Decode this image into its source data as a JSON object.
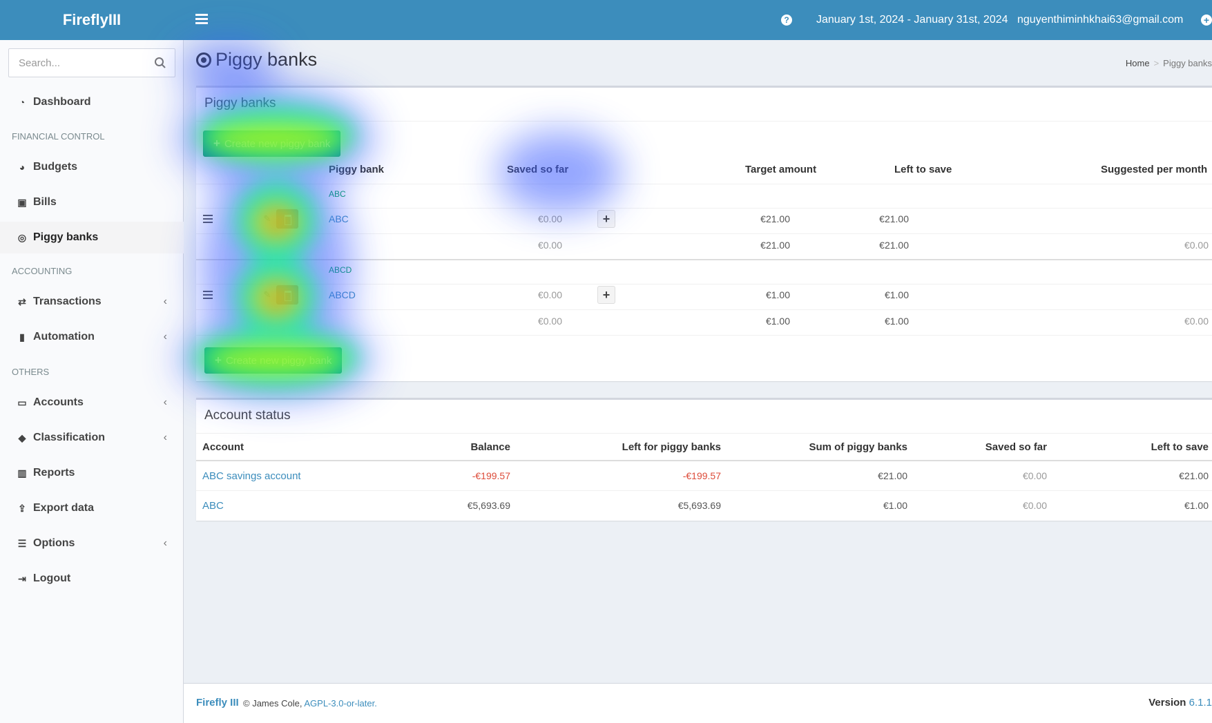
{
  "header": {
    "logo": "FireflyIII",
    "date_range": "January 1st, 2024 - January 31st, 2024",
    "user_email": "nguyenthiminhkhai63@gmail.com"
  },
  "sidebar": {
    "search_placeholder": "Search...",
    "items": [
      {
        "label": "Dashboard"
      },
      {
        "label": "Budgets"
      },
      {
        "label": "Bills"
      },
      {
        "label": "Piggy banks"
      },
      {
        "label": "Transactions"
      },
      {
        "label": "Automation"
      },
      {
        "label": "Accounts"
      },
      {
        "label": "Classification"
      },
      {
        "label": "Reports"
      },
      {
        "label": "Export data"
      },
      {
        "label": "Options"
      },
      {
        "label": "Logout"
      }
    ],
    "headers": [
      "FINANCIAL CONTROL",
      "ACCOUNTING",
      "OTHERS"
    ]
  },
  "page": {
    "title": "Piggy banks",
    "breadcrumb": [
      "Home",
      "Piggy banks"
    ]
  },
  "piggy_box": {
    "title": "Piggy banks",
    "create_label": "Create new piggy bank",
    "columns": [
      "Piggy bank",
      "Saved so far",
      "Target amount",
      "Left to save",
      "Suggested per month"
    ],
    "groups": [
      {
        "account": "ABC",
        "name": "ABC",
        "saved": "€0.00",
        "target": "€21.00",
        "left": "€21.00",
        "sum_saved": "€0.00",
        "sum_target": "€21.00",
        "sum_left": "€21.00",
        "sum_suggested": "€0.00"
      },
      {
        "account": "ABCD",
        "name": "ABCD",
        "saved": "€0.00",
        "target": "€1.00",
        "left": "€1.00",
        "sum_saved": "€0.00",
        "sum_target": "€1.00",
        "sum_left": "€1.00",
        "sum_suggested": "€0.00"
      }
    ]
  },
  "account_box": {
    "title": "Account status",
    "columns": [
      "Account",
      "Balance",
      "Left for piggy banks",
      "Sum of piggy banks",
      "Saved so far",
      "Left to save"
    ],
    "rows": [
      {
        "account": "ABC savings account",
        "balance": "-€199.57",
        "left_for": "-€199.57",
        "sum": "€21.00",
        "saved": "€0.00",
        "left": "€21.00"
      },
      {
        "account": "ABC",
        "balance": "€5,693.69",
        "left_for": "€5,693.69",
        "sum": "€1.00",
        "saved": "€0.00",
        "left": "€1.00"
      }
    ]
  },
  "footer": {
    "brand": "Firefly III",
    "copyright": "© James Cole,",
    "license": "AGPL-3.0-or-later.",
    "version_label": "Version",
    "version": "6.1.1"
  },
  "colors": {
    "header": "#3c8dbc",
    "success": "#00a65a",
    "danger": "#dd4b39"
  }
}
